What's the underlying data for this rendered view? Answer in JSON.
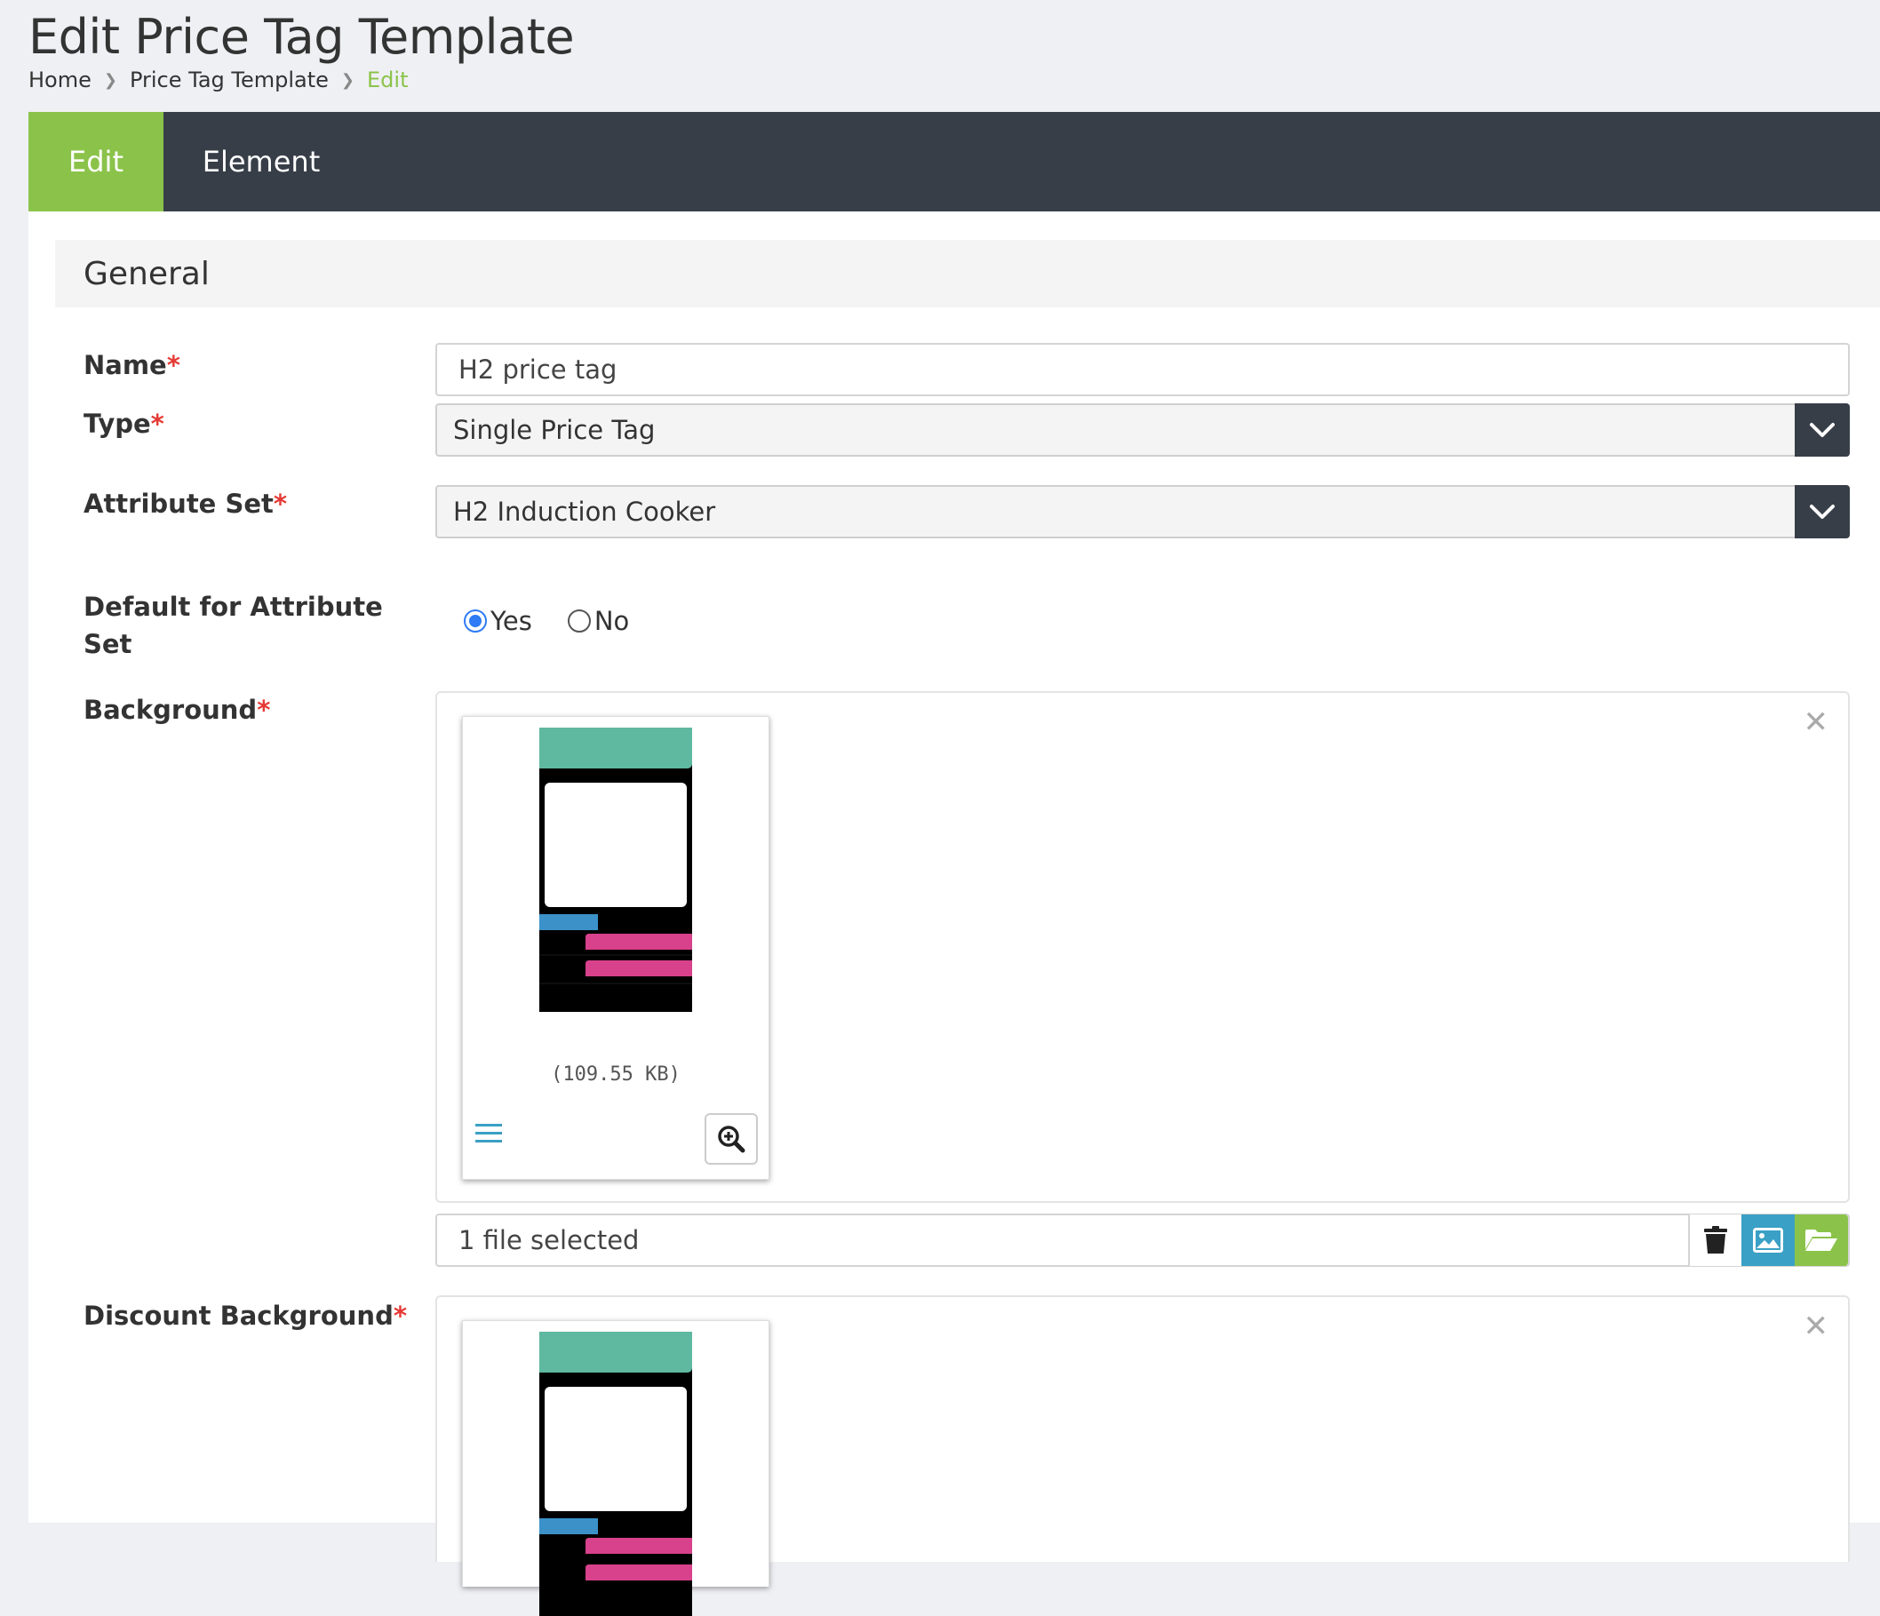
{
  "header": {
    "title": "Edit Price Tag Template",
    "breadcrumb": [
      "Home",
      "Price Tag Template",
      "Edit"
    ]
  },
  "tabs": [
    {
      "label": "Edit",
      "active": true
    },
    {
      "label": "Element",
      "active": false
    }
  ],
  "section": {
    "title": "General"
  },
  "form": {
    "name": {
      "label": "Name",
      "value": "H2 price tag"
    },
    "type": {
      "label": "Type",
      "value": "Single Price Tag"
    },
    "attribute_set": {
      "label": "Attribute Set",
      "value": "H2 Induction Cooker"
    },
    "default": {
      "label_line1": "Default for Attribute",
      "label_line2": "Set",
      "options": [
        "Yes",
        "No"
      ],
      "selected": "Yes"
    },
    "background": {
      "label": "Background",
      "file_size": "(109.55 KB)",
      "file_status": "1 file selected"
    },
    "discount_background": {
      "label": "Discount Background"
    }
  },
  "colors": {
    "accent_green": "#8bc34a",
    "dark_bar": "#373e48",
    "required_red": "#e53935",
    "info_blue": "#3aa0c5",
    "radio_blue": "#2f7bf5"
  },
  "icons": {
    "close": "close-icon",
    "drag": "drag-handle-icon",
    "zoom": "zoom-in-icon",
    "trash": "trash-icon",
    "image": "image-icon",
    "folder": "folder-open-icon",
    "select_arrow": "chevron-down-icon"
  },
  "required_mark": "*"
}
